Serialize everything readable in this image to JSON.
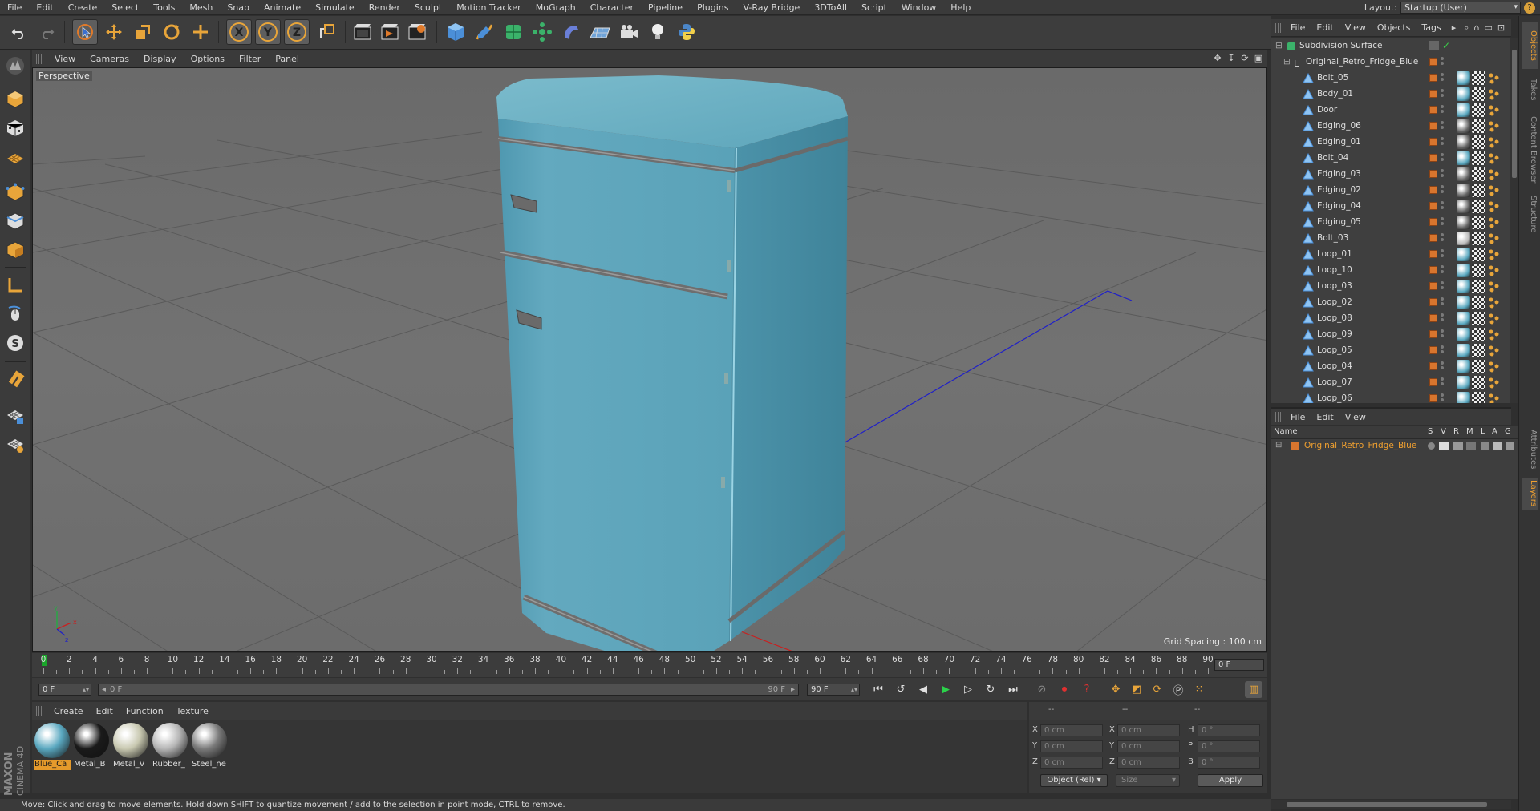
{
  "menubar": {
    "items": [
      "File",
      "Edit",
      "Create",
      "Select",
      "Tools",
      "Mesh",
      "Snap",
      "Animate",
      "Simulate",
      "Render",
      "Sculpt",
      "Motion Tracker",
      "MoGraph",
      "Character",
      "Pipeline",
      "Plugins",
      "V-Ray Bridge",
      "3DToAll",
      "Script",
      "Window",
      "Help"
    ],
    "layout_label": "Layout:",
    "layout_value": "Startup (User)"
  },
  "toolbar": {
    "icons": [
      "undo-icon",
      "redo-icon",
      "live-selection-icon",
      "move-icon",
      "scale-icon",
      "rotate-icon",
      "last-tool-icon",
      "x-axis-icon",
      "y-axis-icon",
      "z-axis-icon",
      "world-coordinates-icon",
      "render-view-icon",
      "render-picture-viewer-icon",
      "render-settings-icon",
      "cube-icon",
      "pen-icon",
      "subdivision-icon",
      "array-icon",
      "deformer-icon",
      "floor-icon",
      "camera-icon",
      "light-icon",
      "python-icon"
    ],
    "axis_labels": [
      "X",
      "Y",
      "Z"
    ]
  },
  "viewport": {
    "menu": [
      "View",
      "Cameras",
      "Display",
      "Options",
      "Filter",
      "Panel"
    ],
    "camera_label": "Perspective",
    "grid_spacing": "Grid Spacing : 100 cm",
    "bg_color": "#6e6e6e",
    "object_color": "#5ea8bd"
  },
  "timeline": {
    "ticks": [
      "0",
      "2",
      "4",
      "6",
      "8",
      "10",
      "12",
      "14",
      "16",
      "18",
      "20",
      "22",
      "24",
      "26",
      "28",
      "30",
      "32",
      "34",
      "36",
      "38",
      "40",
      "42",
      "44",
      "46",
      "48",
      "50",
      "52",
      "54",
      "56",
      "58",
      "60",
      "62",
      "64",
      "66",
      "68",
      "70",
      "72",
      "74",
      "76",
      "78",
      "80",
      "82",
      "84",
      "86",
      "88",
      "90"
    ],
    "current_frame": "0 F"
  },
  "transport": {
    "start": "0 F",
    "scrub_left": "0 F",
    "scrub_right": "90 F",
    "end": "90 F"
  },
  "materials": {
    "menu": [
      "Create",
      "Edit",
      "Function",
      "Texture"
    ],
    "items": [
      {
        "name": "Blue_Ca",
        "color": "#5aa8c0",
        "selected": true
      },
      {
        "name": "Metal_B",
        "color": "#1a1a1a",
        "selected": false
      },
      {
        "name": "Metal_V",
        "color": "#c8c8b0",
        "selected": false
      },
      {
        "name": "Rubber_",
        "color": "#b5b5b5",
        "selected": false
      },
      {
        "name": "Steel_ne",
        "color": "#7a7a7a",
        "selected": false
      }
    ]
  },
  "coordinates": {
    "header": [
      "--",
      "--",
      "--"
    ],
    "rows": [
      {
        "a": "X",
        "av": "0 cm",
        "b": "X",
        "bv": "0 cm",
        "c": "H",
        "cv": "0 °"
      },
      {
        "a": "Y",
        "av": "0 cm",
        "b": "Y",
        "bv": "0 cm",
        "c": "P",
        "cv": "0 °"
      },
      {
        "a": "Z",
        "av": "0 cm",
        "b": "Z",
        "bv": "0 cm",
        "c": "B",
        "cv": "0 °"
      }
    ],
    "mode": "Object (Rel)",
    "size": "Size",
    "apply": "Apply"
  },
  "status": "Move: Click and drag to move elements. Hold down SHIFT to quantize movement / add to the selection in point mode, CTRL to remove.",
  "brand": {
    "top": "MAXON",
    "bottom": "CINEMA 4D"
  },
  "objects": {
    "menu": [
      "File",
      "Edit",
      "View",
      "Objects",
      "Tags"
    ],
    "root": "Subdivision Surface",
    "parent": "Original_Retro_Fridge_Blue",
    "children": [
      "Bolt_05",
      "Body_01",
      "Door",
      "Edging_06",
      "Edging_01",
      "Bolt_04",
      "Edging_03",
      "Edging_02",
      "Edging_04",
      "Edging_05",
      "Bolt_03",
      "Loop_01",
      "Loop_10",
      "Loop_03",
      "Loop_02",
      "Loop_08",
      "Loop_09",
      "Loop_05",
      "Loop_04",
      "Loop_07",
      "Loop_06"
    ]
  },
  "layers": {
    "menu": [
      "File",
      "Edit",
      "View"
    ],
    "columns": [
      "Name",
      "S",
      "V",
      "R",
      "M",
      "L",
      "A",
      "G"
    ],
    "items": [
      "Original_Retro_Fridge_Blue"
    ]
  },
  "side_tabs": [
    "Objects",
    "Takes",
    "Content Browser",
    "Structure",
    "Attributes",
    "Layers"
  ]
}
